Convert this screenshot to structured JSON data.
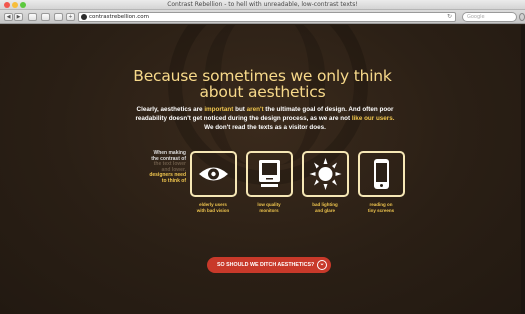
{
  "window": {
    "title": "Contrast Rebellion - to hell with unreadable, low-contrast texts!"
  },
  "toolbar": {
    "back_label": "◀",
    "forward_label": "▶",
    "url": "contrastrebellion.com",
    "reload_label": "↻",
    "search_placeholder": "Google",
    "add_label": "+"
  },
  "page": {
    "headline_line1": "Because sometimes we only think",
    "headline_line2": "about aesthetics",
    "intro": {
      "p1": "Clearly, aesthetics are ",
      "p1_hl": "important",
      "p2": " but ",
      "p2_hl": "aren't",
      "p3": " the ultimate goal of design. And often poor readability doesn't get noticed during the design process, as we are not ",
      "p3_hl": "like our users.",
      "p4": " We don't read the texts as a visitor does."
    },
    "side_note": {
      "l1": "When making",
      "l2": "the contrast of",
      "l3": "the text lower",
      "l4": "and lower,",
      "l5": "designers need",
      "l6": "to think of"
    },
    "cards": [
      {
        "icon": "eye-icon",
        "label1": "elderly users",
        "label2": "with bad vision"
      },
      {
        "icon": "monitor-icon",
        "label1": "low quality",
        "label2": "monitors"
      },
      {
        "icon": "sun-icon",
        "label1": "bad lighting",
        "label2": "and glare"
      },
      {
        "icon": "phone-icon",
        "label1": "reading on",
        "label2": "tiny screens"
      }
    ],
    "cta_label": "SO SHOULD WE DITCH AESTHETICS?",
    "cta_icon": "⌄"
  },
  "colors": {
    "background": "#2b2118",
    "headline": "#f7d98a",
    "highlight": "#f0c64e",
    "card_border": "#f6e7b5",
    "cta": "#c8392a"
  }
}
